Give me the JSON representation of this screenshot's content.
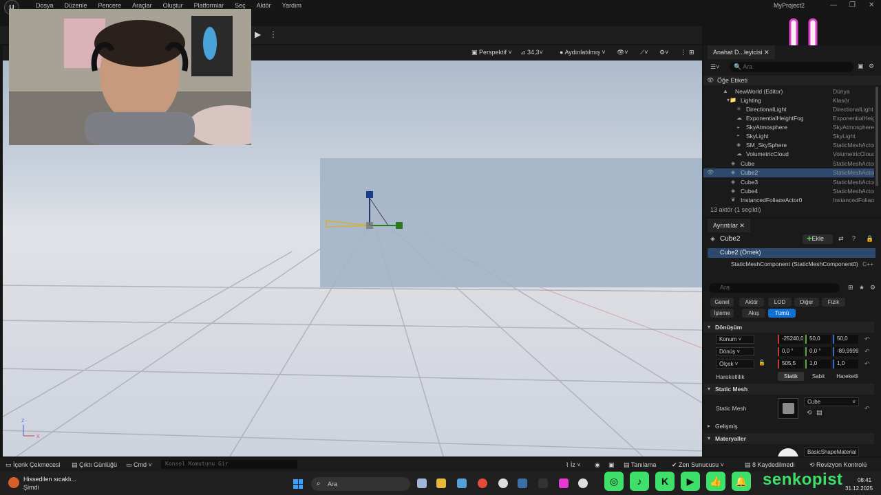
{
  "menu": {
    "items": [
      "Dosya",
      "Düzenle",
      "Pencere",
      "Araçlar",
      "Oluştur",
      "Platformlar",
      "Seç",
      "Aktör",
      "Yardım"
    ],
    "project": "MyProject2"
  },
  "viewport": {
    "perspective": "Perspektif",
    "fov": "34,3",
    "lighting": "Aydınlatılmış",
    "axis_z": "z",
    "axis_x": "x"
  },
  "outliner": {
    "tab": "Anahat D...leyicisi",
    "search_placeholder": "Ara",
    "column_label": "Öğe Etiketi",
    "rows": [
      {
        "name": "NewWorld (Editor)",
        "type": "Dünya",
        "indent": 1,
        "icon": "world-icon"
      },
      {
        "name": "Lighting",
        "type": "Klasör",
        "indent": 2,
        "icon": "folder-icon"
      },
      {
        "name": "DirectionalLight",
        "type": "DirectionalLight",
        "indent": 3,
        "icon": "light-icon"
      },
      {
        "name": "ExponentialHeightFog",
        "type": "ExponentialHeightFog",
        "indent": 3,
        "icon": "fog-icon"
      },
      {
        "name": "SkyAtmosphere",
        "type": "SkyAtmosphere",
        "indent": 3,
        "icon": "atmosphere-icon"
      },
      {
        "name": "SkyLight",
        "type": "SkyLight",
        "indent": 3,
        "icon": "skylight-icon"
      },
      {
        "name": "SM_SkySphere",
        "type": "StaticMeshActor",
        "indent": 3,
        "icon": "mesh-icon"
      },
      {
        "name": "VolumetricCloud",
        "type": "VolumetricCloud",
        "indent": 3,
        "icon": "cloud-icon"
      },
      {
        "name": "Cube",
        "type": "StaticMeshActor",
        "indent": 2,
        "icon": "mesh-icon"
      },
      {
        "name": "Cube2",
        "type": "StaticMeshActor",
        "indent": 2,
        "icon": "mesh-icon",
        "selected": true
      },
      {
        "name": "Cube3",
        "type": "StaticMeshActor",
        "indent": 2,
        "icon": "mesh-icon"
      },
      {
        "name": "Cube4",
        "type": "StaticMeshActor",
        "indent": 2,
        "icon": "mesh-icon"
      },
      {
        "name": "InstancedFoliageActor0",
        "type": "InstancedFoliageActor",
        "indent": 2,
        "icon": "foliage-icon"
      }
    ],
    "footer": "13 aktör (1 seçildi)"
  },
  "details": {
    "tab": "Ayrıntılar",
    "actor_name": "Cube2",
    "add_label": "Ekle",
    "component_root": "Cube2 (Örnek)",
    "component_child": "StaticMeshComponent (StaticMeshComponent0)",
    "component_child_tag": "C++",
    "search_placeholder": "Ara",
    "filters": [
      "Genel",
      "Aktör",
      "LOD",
      "Diğer",
      "Fizik",
      "İşleme",
      "Akış",
      "Tümü"
    ],
    "active_filter": "Tümü",
    "transform_section": "Dönüşüm",
    "location_label": "Konum",
    "location": [
      "-25240,0",
      "50,0",
      "50,0"
    ],
    "rotation_label": "Dönüş",
    "rotation": [
      "0,0 °",
      "0,0 °",
      "-89,9999"
    ],
    "scale_label": "Ölçek",
    "scale": [
      "505,5",
      "1,0",
      "1,0"
    ],
    "mobility_label": "Hareketlilik",
    "mobility_options": [
      "Statik",
      "Sabit",
      "Hareketli"
    ],
    "mobility_selected": "Statik",
    "static_mesh_section": "Static Mesh",
    "static_mesh_label": "Static Mesh",
    "static_mesh_value": "Cube",
    "advanced_section": "Gelişmiş",
    "materials_section": "Materyaller",
    "material_value": "BasicShapeMaterial"
  },
  "statusbar": {
    "content_drawer": "İçerik Çekmecesi",
    "output_log": "Çıktı Günlüğü",
    "cmd": "Cmd",
    "console_placeholder": "Konsol Komutunu Gir",
    "trace": "İz",
    "derive": "Tanılama",
    "zen": "Zen Sunucusu",
    "unsaved": "8 Kaydedilmedi",
    "revision": "Revizyon Kontrolü"
  },
  "taskbar": {
    "weather_title": "Hissedilen sıcaklı...",
    "weather_sub": "Şimdi",
    "search": "Ara",
    "time": "08:41",
    "date": "31.12.2025"
  },
  "overlay": {
    "channel": "senkopist"
  },
  "colors": {
    "accent": "#1370d3",
    "selection": "#2d4a6e",
    "overlay_green": "#3fe06a",
    "overlay_pink": "#e040c8"
  }
}
